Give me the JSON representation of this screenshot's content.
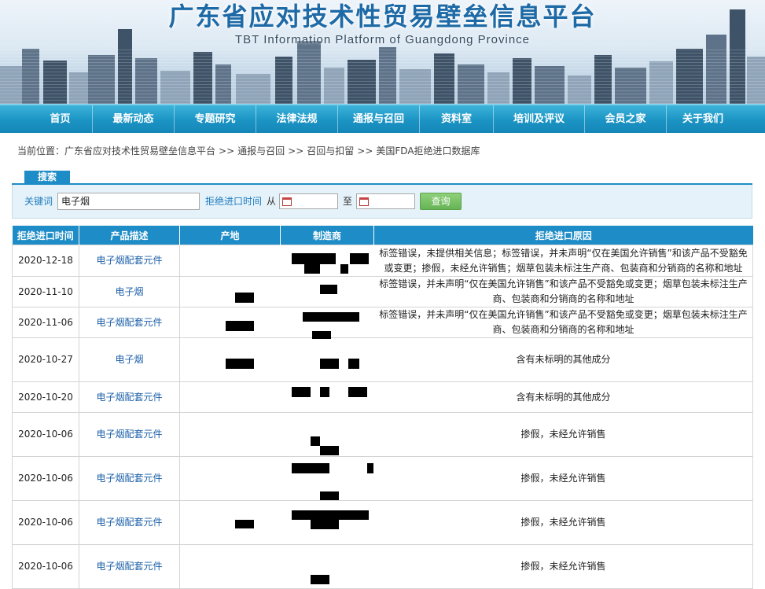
{
  "header": {
    "title_cn": "广东省应对技术性贸易壁垒信息平台",
    "title_en": "TBT Information Platform of Guangdong Province"
  },
  "nav": {
    "items": [
      {
        "label": "首页"
      },
      {
        "label": "最新动态"
      },
      {
        "label": "专题研究"
      },
      {
        "label": "法律法规"
      },
      {
        "label": "通报与召回"
      },
      {
        "label": "资料室"
      },
      {
        "label": "培训及评议"
      },
      {
        "label": "会员之家"
      },
      {
        "label": "关于我们"
      }
    ]
  },
  "breadcrumb": {
    "prefix": "当前位置：",
    "items": [
      "广东省应对技术性贸易壁垒信息平台",
      "通报与召回",
      "召回与扣留",
      "美国FDA拒绝进口数据库"
    ],
    "separator": ">>"
  },
  "search": {
    "tab_label": "搜索",
    "keyword_label": "关键词",
    "keyword_value": "电子烟",
    "date_label": "拒绝进口时间",
    "from_label": "从",
    "to_label": "至",
    "from_value": "",
    "to_value": "",
    "query_button": "查询"
  },
  "table": {
    "headers": [
      "拒绝进口时间",
      "产品描述",
      "产地",
      "制造商",
      "拒绝进口原因"
    ],
    "rows": [
      {
        "date": "2020-12-18",
        "product": "电子烟配套元件",
        "reason": "标签错误，未提供相关信息；标签错误，并未声明“仅在美国允许销售”和该产品不受豁免或变更；掺假，未经允许销售；烟草包装未标注生产商、包装商和分销商的名称和地址"
      },
      {
        "date": "2020-11-10",
        "product": "电子烟",
        "reason": "标签错误，并未声明“仅在美国允许销售”和该产品不受豁免或变更；烟草包装未标注生产商、包装商和分销商的名称和地址"
      },
      {
        "date": "2020-11-06",
        "product": "电子烟配套元件",
        "reason": "标签错误，并未声明“仅在美国允许销售”和该产品不受豁免或变更；烟草包装未标注生产商、包装商和分销商的名称和地址"
      },
      {
        "date": "2020-10-27",
        "product": "电子烟",
        "reason": "含有未标明的其他成分"
      },
      {
        "date": "2020-10-20",
        "product": "电子烟配套元件",
        "reason": "含有未标明的其他成分"
      },
      {
        "date": "2020-10-06",
        "product": "电子烟配套元件",
        "reason": "掺假，未经允许销售"
      },
      {
        "date": "2020-10-06",
        "product": "电子烟配套元件",
        "reason": "掺假，未经允许销售"
      },
      {
        "date": "2020-10-06",
        "product": "电子烟配套元件",
        "reason": "掺假，未经允许销售"
      },
      {
        "date": "2020-10-06",
        "product": "电子烟配套元件",
        "reason": "掺假，未经允许销售"
      }
    ]
  }
}
